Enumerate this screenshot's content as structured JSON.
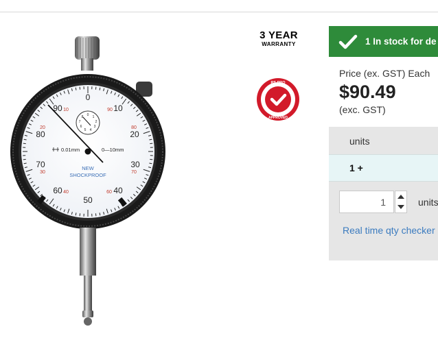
{
  "warranty": {
    "line1": "3 YEAR",
    "line2": "WARRANTY"
  },
  "badge": {
    "top": "RS PRO",
    "bottom": "APPROVED",
    "icon": "check-icon"
  },
  "stock": {
    "text": "1 In stock for de",
    "icon": "check-icon",
    "color": "#2e8b3a"
  },
  "price": {
    "label": "Price (ex. GST) Each",
    "value": "$90.49",
    "note": "(exc. GST)"
  },
  "table": {
    "units_header": "units",
    "tier_label": "1 +"
  },
  "quantity": {
    "value": "1",
    "suffix": "units"
  },
  "qty_checker_link": "Real time qty checker",
  "gauge": {
    "labels_major": [
      "0",
      "10",
      "20",
      "30",
      "40",
      "50",
      "60",
      "70",
      "80",
      "90"
    ],
    "labels_minor_red": [
      "10",
      "20",
      "30",
      "40",
      "60",
      "70",
      "80",
      "90"
    ],
    "resolution": "0.01mm",
    "range": "0—10mm",
    "line1": "NEW",
    "line2": "SHOCKPROOF",
    "sub_dial": [
      "0",
      "1",
      "2",
      "3",
      "4",
      "5",
      "6",
      "7",
      "8",
      "9"
    ]
  }
}
